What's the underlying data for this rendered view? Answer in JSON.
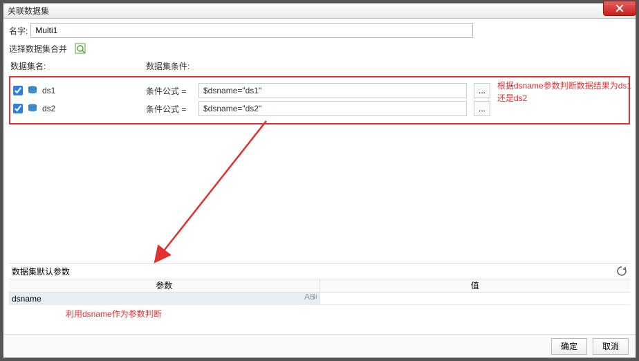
{
  "window": {
    "title": "关联数据集"
  },
  "name_row": {
    "label": "名字:",
    "value": "Multi1"
  },
  "merge_row": {
    "label": "选择数据集合并"
  },
  "headers": {
    "name": "数据集名:",
    "cond": "数据集条件:"
  },
  "cond_label": "条件公式 =",
  "datasets": [
    {
      "checked": true,
      "name": "ds1",
      "formula": "$dsname=\"ds1\""
    },
    {
      "checked": true,
      "name": "ds2",
      "formula": "$dsname=\"ds2\""
    }
  ],
  "annotations": {
    "right": "根据dsname参数判断数据结果为ds1还是ds2",
    "bottom": "利用dsname作为参数判断"
  },
  "params_section": {
    "title": "数据集默认参数",
    "col_param": "参数",
    "col_value": "值"
  },
  "param_rows": [
    {
      "name": "dsname",
      "value": ""
    }
  ],
  "footer": {
    "ok": "确定",
    "cancel": "取消"
  },
  "dots": "..."
}
